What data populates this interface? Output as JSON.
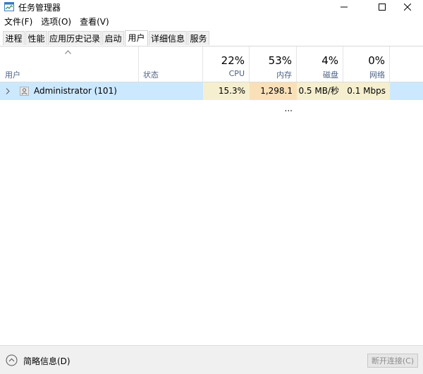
{
  "window": {
    "title": "任务管理器",
    "minimize_glyph": "—",
    "maximize_glyph": "☐",
    "close_glyph": "✕"
  },
  "menu": [
    "文件(F)",
    "选项(O)",
    "查看(V)"
  ],
  "tabs": [
    "进程",
    "性能",
    "应用历史记录",
    "启动",
    "用户",
    "详细信息",
    "服务"
  ],
  "active_tab": "用户",
  "columns": {
    "user": {
      "label": "用户"
    },
    "status": {
      "label": "状态"
    },
    "cpu": {
      "pct": "22%",
      "label": "CPU"
    },
    "memory": {
      "pct": "53%",
      "label": "内存"
    },
    "disk": {
      "pct": "4%",
      "label": "磁盘"
    },
    "network": {
      "pct": "0%",
      "label": "网络"
    }
  },
  "rows": [
    {
      "user": "Administrator (101)",
      "status": "",
      "cpu": "15.3%",
      "memory": "1,298.1 ...",
      "disk": "0.5 MB/秒",
      "network": "0.1 Mbps"
    }
  ],
  "footer": {
    "fewer_details": "简略信息(D)",
    "disconnect_button": "断开连接(C)"
  },
  "colors": {
    "selection": "#cce8ff",
    "heat_cpu": "#f5efcf",
    "heat_memory": "#f9e0b9",
    "heat_disk": "#f5efcf",
    "heat_network": "#f5efcf",
    "header_label": "#4d6082"
  },
  "icons": {
    "app": "task-manager-icon",
    "sort": "sort-up-caret-icon",
    "expand": "chevron-right-icon",
    "user": "user-icon",
    "collapse": "chevron-up-circle-icon"
  }
}
